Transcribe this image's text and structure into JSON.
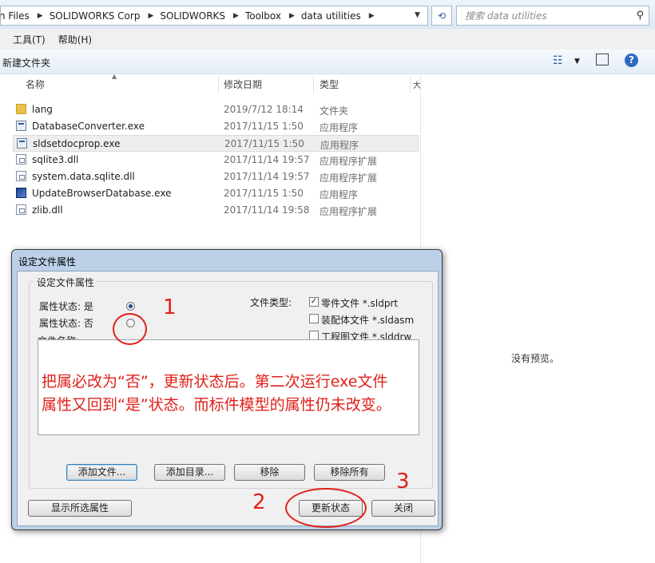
{
  "address": {
    "crumbs": [
      "n Files",
      "SOLIDWORKS Corp",
      "SOLIDWORKS",
      "Toolbox",
      "data utilities"
    ],
    "search_placeholder": "搜索 data utilities"
  },
  "menu": [
    "工具(T)",
    "帮助(H)"
  ],
  "toolbar": {
    "new_folder": "新建文件夹"
  },
  "columns": {
    "name": "名称",
    "date": "修改日期",
    "type": "类型",
    "size": "大"
  },
  "files": [
    {
      "name": "lang",
      "date": "2019/7/12 18:14",
      "type": "文件夹",
      "icon": "folder-icon"
    },
    {
      "name": "DatabaseConverter.exe",
      "date": "2017/11/15 1:50",
      "type": "应用程序",
      "icon": "exe-icon"
    },
    {
      "name": "sldsetdocprop.exe",
      "date": "2017/11/15 1:50",
      "type": "应用程序",
      "icon": "exe-icon"
    },
    {
      "name": "sqlite3.dll",
      "date": "2017/11/14 19:57",
      "type": "应用程序扩展",
      "icon": "dll-icon"
    },
    {
      "name": "system.data.sqlite.dll",
      "date": "2017/11/14 19:57",
      "type": "应用程序扩展",
      "icon": "dll-icon"
    },
    {
      "name": "UpdateBrowserDatabase.exe",
      "date": "2017/11/15 1:50",
      "type": "应用程序",
      "icon": "update-exe-icon"
    },
    {
      "name": "zlib.dll",
      "date": "2017/11/14 19:58",
      "type": "应用程序扩展",
      "icon": "dll-icon"
    }
  ],
  "preview": "没有预览。",
  "dialog": {
    "title": "设定文件属性",
    "group_title": "设定文件属性",
    "prop_yes": "属性状态: 是",
    "prop_no": "属性状态: 否",
    "file_types_label": "文件类型:",
    "types": [
      {
        "label": "零件文件 *.sldprt",
        "checked": true
      },
      {
        "label": "装配体文件 *.sldasm",
        "checked": false
      },
      {
        "label": "工程图文件 *.slddrw",
        "checked": false
      }
    ],
    "filename_label": "文件名称:",
    "annotation_line1": "把属必改为“否”，更新状态后。第二次运行exe文件",
    "annotation_line2": "属性又回到“是”状态。而标件模型的属性仍未改变。",
    "buttons": {
      "add_file": "添加文件...",
      "add_dir": "添加目录...",
      "remove": "移除",
      "remove_all": "移除所有",
      "show_props": "显示所选属性",
      "update": "更新状态",
      "close": "关闭"
    },
    "selected_state": "是"
  },
  "marks": [
    "1",
    "2",
    "3"
  ]
}
